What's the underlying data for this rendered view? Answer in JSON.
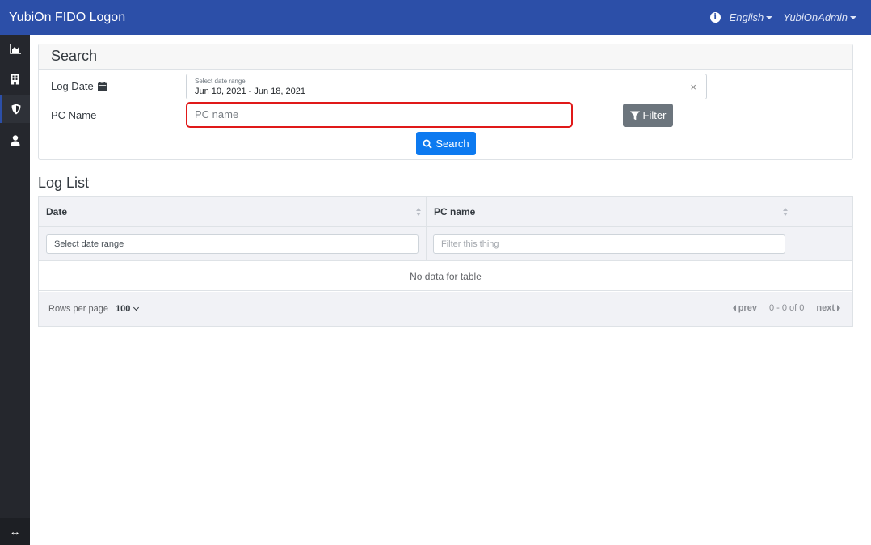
{
  "app": {
    "title": "YubiOn FIDO Logon"
  },
  "navbar": {
    "info_icon": "info-circle-icon",
    "language": "English",
    "user": "YubiOnAdmin"
  },
  "sidebar": {
    "items": [
      {
        "icon": "chart-area-icon",
        "active": false
      },
      {
        "icon": "building-icon",
        "active": false
      },
      {
        "icon": "shield-icon",
        "active": true
      },
      {
        "icon": "user-icon",
        "active": false
      }
    ],
    "toggle_icon": "arrows-horizontal-icon"
  },
  "search": {
    "title": "Search",
    "log_date_label": "Log Date",
    "date_range_caption": "Select date range",
    "date_range_value": "Jun 10, 2021 - Jun 18, 2021",
    "clear_symbol": "×",
    "pc_name_label": "PC Name",
    "pc_name_placeholder": "PC name",
    "pc_name_value": "",
    "filter_label": "Filter",
    "search_label": "Search"
  },
  "log_list": {
    "title": "Log List",
    "columns": [
      "Date",
      "PC name"
    ],
    "date_filter_placeholder": "Select date range",
    "pc_filter_placeholder": "Filter this thing",
    "empty_text": "No data for table",
    "rows_per_page_label": "Rows per page",
    "rows_per_page_value": "100",
    "prev_label": "prev",
    "page_info": "0 - 0 of 0",
    "next_label": "next"
  },
  "colors": {
    "navbar": "#2c4fa8",
    "sidebar": "#25272d",
    "primary_button": "#0d7af0",
    "secondary_button": "#6c757d",
    "highlight_border": "#e01919"
  }
}
